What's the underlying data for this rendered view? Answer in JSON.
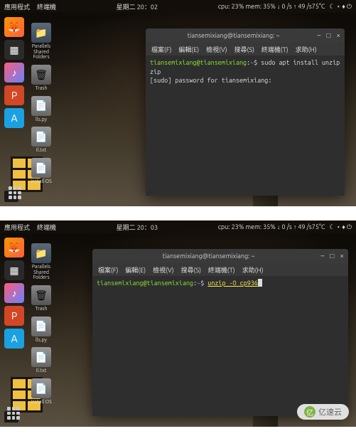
{
  "topbar": {
    "app_menu": "應用程式",
    "terminal_menu": "終端機",
    "datetime_1": "星期二 20：02",
    "datetime_2": "星期二 20：03",
    "stats": "cpu: 23% mem: 35% ↓ 0 /s ↑ 49 /s75°C",
    "indicators": "☾ ⋆ ♦ ⏻"
  },
  "dock": {
    "firefox": "firefox-icon",
    "parallels": "parallels-icon",
    "itunes": "itunes-icon",
    "powerpoint": "powerpoint-icon",
    "appstore": "appstore-icon"
  },
  "desktop": [
    {
      "icon": "folder",
      "label": "Parallels Shared Folders"
    },
    {
      "icon": "trash",
      "label": "Trash"
    },
    {
      "icon": "file",
      "label": "lls.py"
    },
    {
      "icon": "file",
      "label": "Il.txt"
    },
    {
      "icon": "file",
      "label": "Install\nOS"
    }
  ],
  "terminal": {
    "title": "tiansemixiang@tiansemixiang: ~",
    "menu": [
      "檔案(F)",
      "編輯(E)",
      "檢視(V)",
      "搜尋(S)",
      "終端機(T)",
      "求助(H)"
    ],
    "prompt_user": "tiansemixiang@tiansemixiang",
    "prompt_sep": ":",
    "prompt_path": "~",
    "prompt_dollar": "$",
    "shot1": {
      "cmd": "sudo apt install unzip zip",
      "line2": "[sudo] password for tiansemixiang:"
    },
    "shot2": {
      "cmd_prefix": "unzip -O cp936"
    },
    "controls": {
      "min": "–",
      "max": "□",
      "close": "×"
    }
  },
  "apps_button": "apps-grid",
  "watermark": {
    "logo": "亿",
    "text": "亿速云"
  }
}
